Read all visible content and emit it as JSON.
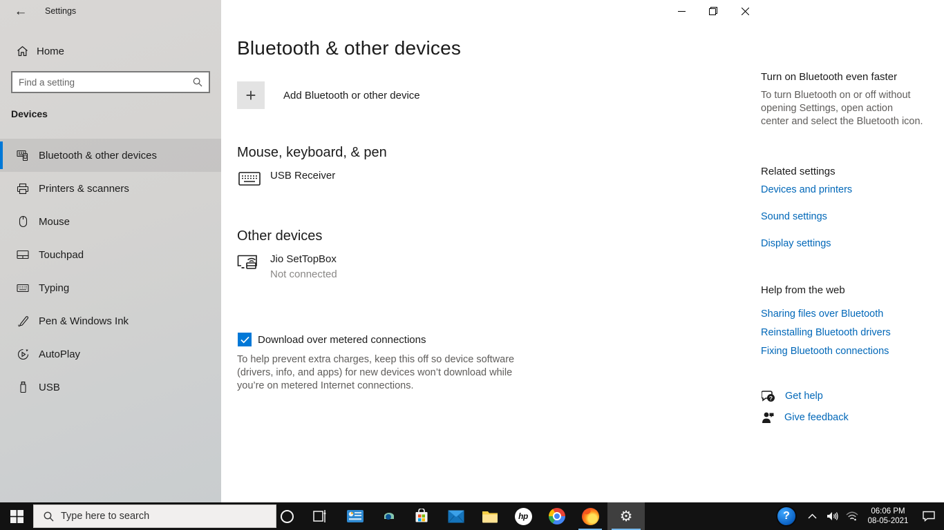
{
  "colors": {
    "accent": "#0078d7",
    "link": "#0067b8",
    "taskbar": "#121212",
    "underline": "#76b9ed"
  },
  "icons": {
    "plus": "+",
    "back_arrow": "←",
    "gear": "⚙"
  },
  "window": {
    "title": "Settings"
  },
  "sidebar": {
    "home_label": "Home",
    "search_placeholder": "Find a setting",
    "section_label": "Devices",
    "items": [
      {
        "label": "Bluetooth & other devices",
        "selected": true
      },
      {
        "label": "Printers & scanners",
        "selected": false
      },
      {
        "label": "Mouse",
        "selected": false
      },
      {
        "label": "Touchpad",
        "selected": false
      },
      {
        "label": "Typing",
        "selected": false
      },
      {
        "label": "Pen & Windows Ink",
        "selected": false
      },
      {
        "label": "AutoPlay",
        "selected": false
      },
      {
        "label": "USB",
        "selected": false
      }
    ]
  },
  "main": {
    "page_title": "Bluetooth & other devices",
    "add_button_label": "Add Bluetooth or other device",
    "section1_heading": "Mouse, keyboard, & pen",
    "device1_name": "USB Receiver",
    "section2_heading": "Other devices",
    "device2_name": "Jio SetTopBox",
    "device2_status": "Not connected",
    "metered_label": "Download over metered connections",
    "metered_checked": true,
    "metered_description": "To help prevent extra charges, keep this off so device software (drivers, info, and apps) for new devices won’t download while you’re on metered Internet connections."
  },
  "aside": {
    "tip_title": "Turn on Bluetooth even faster",
    "tip_body": "To turn Bluetooth on or off without opening Settings, open action center and select the Bluetooth icon.",
    "related_heading": "Related settings",
    "related_links": [
      {
        "label": "Devices and printers"
      },
      {
        "label": "Sound settings"
      },
      {
        "label": "Display settings"
      }
    ],
    "web_heading": "Help from the web",
    "web_links": [
      {
        "label": "Sharing files over Bluetooth"
      },
      {
        "label": "Reinstalling Bluetooth drivers"
      },
      {
        "label": "Fixing Bluetooth connections"
      }
    ],
    "get_help_label": "Get help",
    "give_feedback_label": "Give feedback"
  },
  "taskbar": {
    "search_placeholder": "Type here to search",
    "clock": {
      "time": "06:06 PM",
      "date": "08-05-2021"
    }
  }
}
